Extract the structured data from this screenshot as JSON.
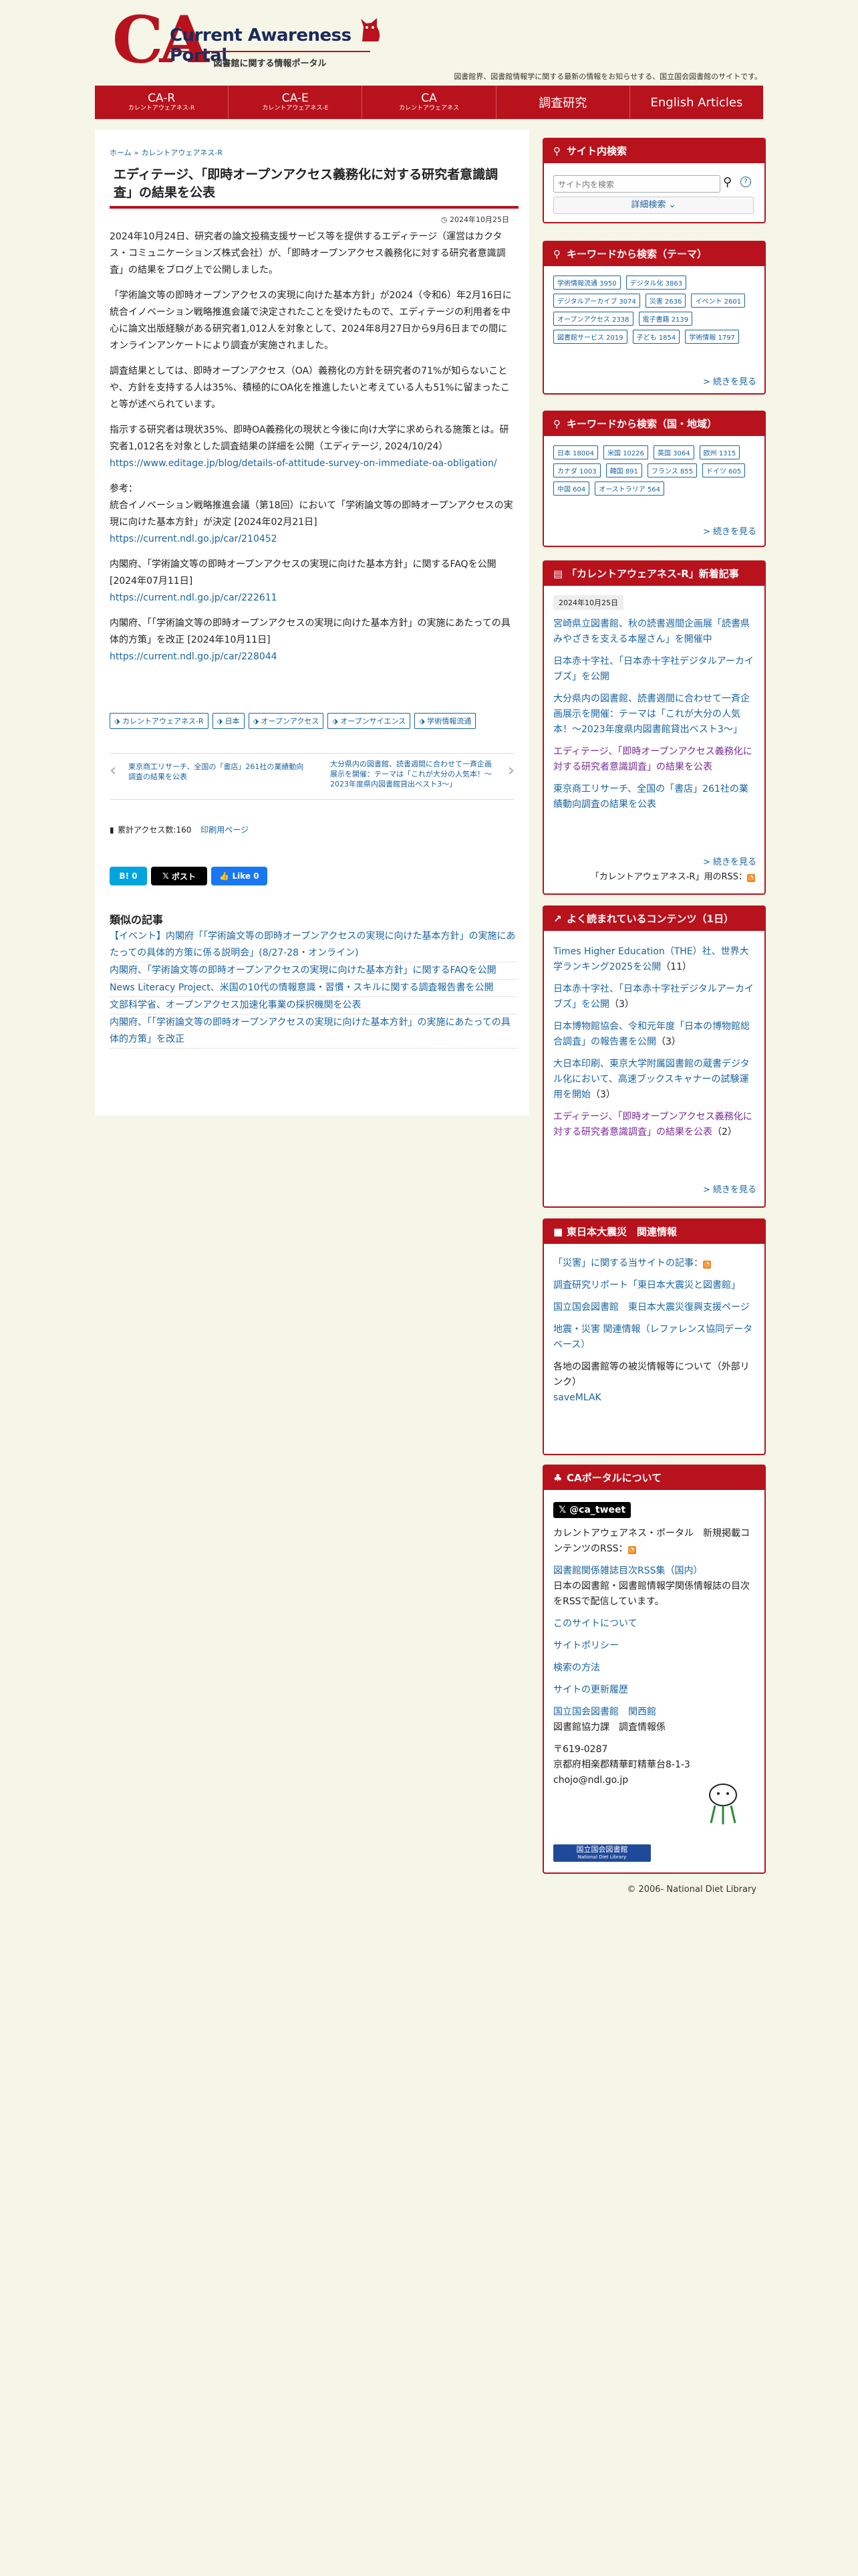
{
  "header": {
    "logo_letters": "CA",
    "logo_title": "Current Awareness Portal",
    "logo_subtitle": "図書館に関する情報ポータル",
    "tagline": "図書館界、図書館情報学に関する最新の情報をお知らせする、国立国会図書館のサイトです。"
  },
  "nav": [
    {
      "main": "CA-R",
      "sub": "カレントアウェアネス-R"
    },
    {
      "main": "CA-E",
      "sub": "カレントアウェアネス-E"
    },
    {
      "main": "CA",
      "sub": "カレントアウェアネス"
    },
    {
      "main": "調査研究",
      "sub": ""
    },
    {
      "main": "English Articles",
      "sub": ""
    }
  ],
  "breadcrumb": {
    "home": "ホーム",
    "sep": "»",
    "current": "カレントアウェアネス-R"
  },
  "article": {
    "title": "エディテージ、「即時オープンアクセス義務化に対する研究者意識調査」の結果を公表",
    "date": "2024年10月25日",
    "p1": "2024年10月24日、研究者の論文投稿支援サービス等を提供するエディテージ（運営はカクタス・コミュニケーションズ株式会社）が、「即時オープンアクセス義務化に対する研究者意識調査」の結果をブログ上で公開しました。",
    "p2": "「学術論文等の即時オープンアクセスの実現に向けた基本方針」が2024（令和6）年2月16日に統合イノベーション戦略推進会議で決定されたことを受けたもので、エディテージの利用者を中心に論文出版経験がある研究者1,012人を対象として、2024年8月27日から9月6日までの間にオンラインアンケートにより調査が実施されました。",
    "p3": "調査結果としては、即時オープンアクセス（OA）義務化の方針を研究者の71%が知らないことや、方針を支持する人は35%、積極的にOA化を推進したいと考えている人も51%に留まったこと等が述べられています。",
    "p4": "指示する研究者は現状35%、即時OA義務化の現状と今後に向け大学に求められる施策とは。研究者1,012名を対象とした調査結果の詳細を公開（エディテージ, 2024/10/24）",
    "link1": "https://www.editage.jp/blog/details-of-attitude-survey-on-immediate-oa-obligation/",
    "ref_label": "参考：",
    "ref1_text": "統合イノベーション戦略推進会議（第18回）において「学術論文等の即時オープンアクセスの実現に向けた基本方針」が決定 [2024年02月21日]",
    "ref1_link": "https://current.ndl.go.jp/car/210452",
    "ref2_text": "内閣府、「学術論文等の即時オープンアクセスの実現に向けた基本方針」に関するFAQを公開 [2024年07月11日]",
    "ref2_link": "https://current.ndl.go.jp/car/222611",
    "ref3_text": "内閣府、「「学術論文等の即時オープンアクセスの実現に向けた基本方針」の実施にあたっての具体的方策」を改正 [2024年10月11日]",
    "ref3_link": "https://current.ndl.go.jp/car/228044",
    "tags": [
      "カレントアウェアネス-R",
      "日本",
      "オープンアクセス",
      "オープンサイエンス",
      "学術情報流通"
    ],
    "prev": "東京商工リサーチ、全国の「書店」261社の業績動向調査の結果を公表",
    "next": "大分県内の図書館、読書週間に合わせて一斉企画展示を開催：テーマは「これが大分の人気本！～2023年度県内図書館貸出ベスト3～」",
    "access": "累計アクセス数:160",
    "print": "印刷用ページ",
    "share_hatena": "B! 0",
    "share_post": "ポスト",
    "share_like": "Like 0"
  },
  "similar": {
    "heading": "類似の記事",
    "items": [
      "【イベント】内閣府「「学術論文等の即時オープンアクセスの実現に向けた基本方針」の実施にあたっての具体的方策に係る説明会」(8/27-28・オンライン)",
      "内閣府、「学術論文等の即時オープンアクセスの実現に向けた基本方針」に関するFAQを公開",
      "News Literacy Project、米国の10代の情報意識・習慣・スキルに関する調査報告書を公開",
      "文部科学省、オープンアクセス加速化事業の採択機関を公表",
      "内閣府、「「学術論文等の即時オープンアクセスの実現に向けた基本方針」の実施にあたっての具体的方策」を改正"
    ]
  },
  "sidebar": {
    "search": {
      "title": "サイト内検索",
      "placeholder": "サイト内を検索",
      "advanced": "詳細検索"
    },
    "theme": {
      "title": "キーワードから検索（テーマ）",
      "tags": [
        "学術情報流通 3950",
        "デジタル化 3863",
        "デジタルアーカイブ 3074",
        "災害 2636",
        "イベント 2601",
        "オープンアクセス 2338",
        "電子書籍 2139",
        "図書館サービス 2019",
        "子ども 1854",
        "学術情報 1797"
      ],
      "more": "> 続きを見る"
    },
    "region": {
      "title": "キーワードから検索（国・地域）",
      "tags": [
        "日本 18004",
        "米国 10226",
        "英国 3064",
        "欧州 1315",
        "カナダ 1003",
        "韓国 891",
        "フランス 855",
        "ドイツ 605",
        "中国 604",
        "オーストラリア 564"
      ],
      "more": "> 続きを見る"
    },
    "newest": {
      "title": "「カレントアウェアネス-R」新着記事",
      "date": "2024年10月25日",
      "items": [
        "宮崎県立図書館、秋の読書週間企画展「読書県みやざきを支える本屋さん」を開催中",
        "日本赤十字社、「日本赤十字社デジタルアーカイブズ」を公開",
        "大分県内の図書館、読書週間に合わせて一斉企画展示を開催：テーマは「これが大分の人気本！～2023年度県内図書館貸出ベスト3～」",
        "エディテージ、「即時オープンアクセス義務化に対する研究者意識調査」の結果を公表",
        "東京商工リサーチ、全国の「書店」261社の業績動向調査の結果を公表"
      ],
      "more": "> 続きを見る",
      "rss": "「カレントアウェアネス-R」用のRSS："
    },
    "popular": {
      "title": "よく読まれているコンテンツ（1日）",
      "items": [
        {
          "text": "Times Higher Education（THE）社、世界大学ランキング2025を公開",
          "count": "（11）"
        },
        {
          "text": "日本赤十字社、「日本赤十字社デジタルアーカイブズ」を公開",
          "count": "（3）"
        },
        {
          "text": "日本博物館協会、令和元年度「日本の博物館総合調査」の報告書を公開",
          "count": "（3）"
        },
        {
          "text": "大日本印刷、東京大学附属図書館の蔵書デジタル化において、高速ブックスキャナーの試験運用を開始",
          "count": "（3）"
        },
        {
          "text": "エディテージ、「即時オープンアクセス義務化に対する研究者意識調査」の結果を公表",
          "count": "（2）"
        }
      ],
      "more": "> 続きを見る"
    },
    "disaster": {
      "title": "東日本大震災　関連情報",
      "items": [
        "「災害」に関する当サイトの記事：",
        "調査研究リポート「東日本大震災と図書館」",
        "国立国会図書館　東日本大震災復興支援ページ",
        "地震・災害 関連情報（レファレンス協同データベース）"
      ],
      "plain": "各地の図書館等の被災情報等について（外部リンク）",
      "savemlak": "saveMLAK"
    },
    "about": {
      "title": "CAポータルについて",
      "twitter": "@ca_tweet",
      "rss_line": "カレントアウェアネス・ポータル　新規掲載コンテンツのRSS：",
      "link_rss": "図書館関係雑誌目次RSS集（国内）",
      "rss_desc": "日本の図書館・図書館情報学関係情報誌の目次をRSSで配信しています。",
      "links": [
        "このサイトについて",
        "サイトポリシー",
        "検索の方法",
        "サイトの更新履歴",
        "国立国会図書館　関西館"
      ],
      "dept": "図書館協力課　調査情報係",
      "addr1": "〒619-0287",
      "addr2": "京都府相楽郡精華町精華台8-1-3",
      "email": "chojo@ndl.go.jp",
      "ndl_badge": "国立国会図書館",
      "ndl_badge_en": "National Diet Library"
    }
  },
  "footer": "© 2006- National Diet Library",
  "colors": {
    "accent": "#b8121d",
    "link": "#1a64a0",
    "bg": "#f5f6e8"
  }
}
